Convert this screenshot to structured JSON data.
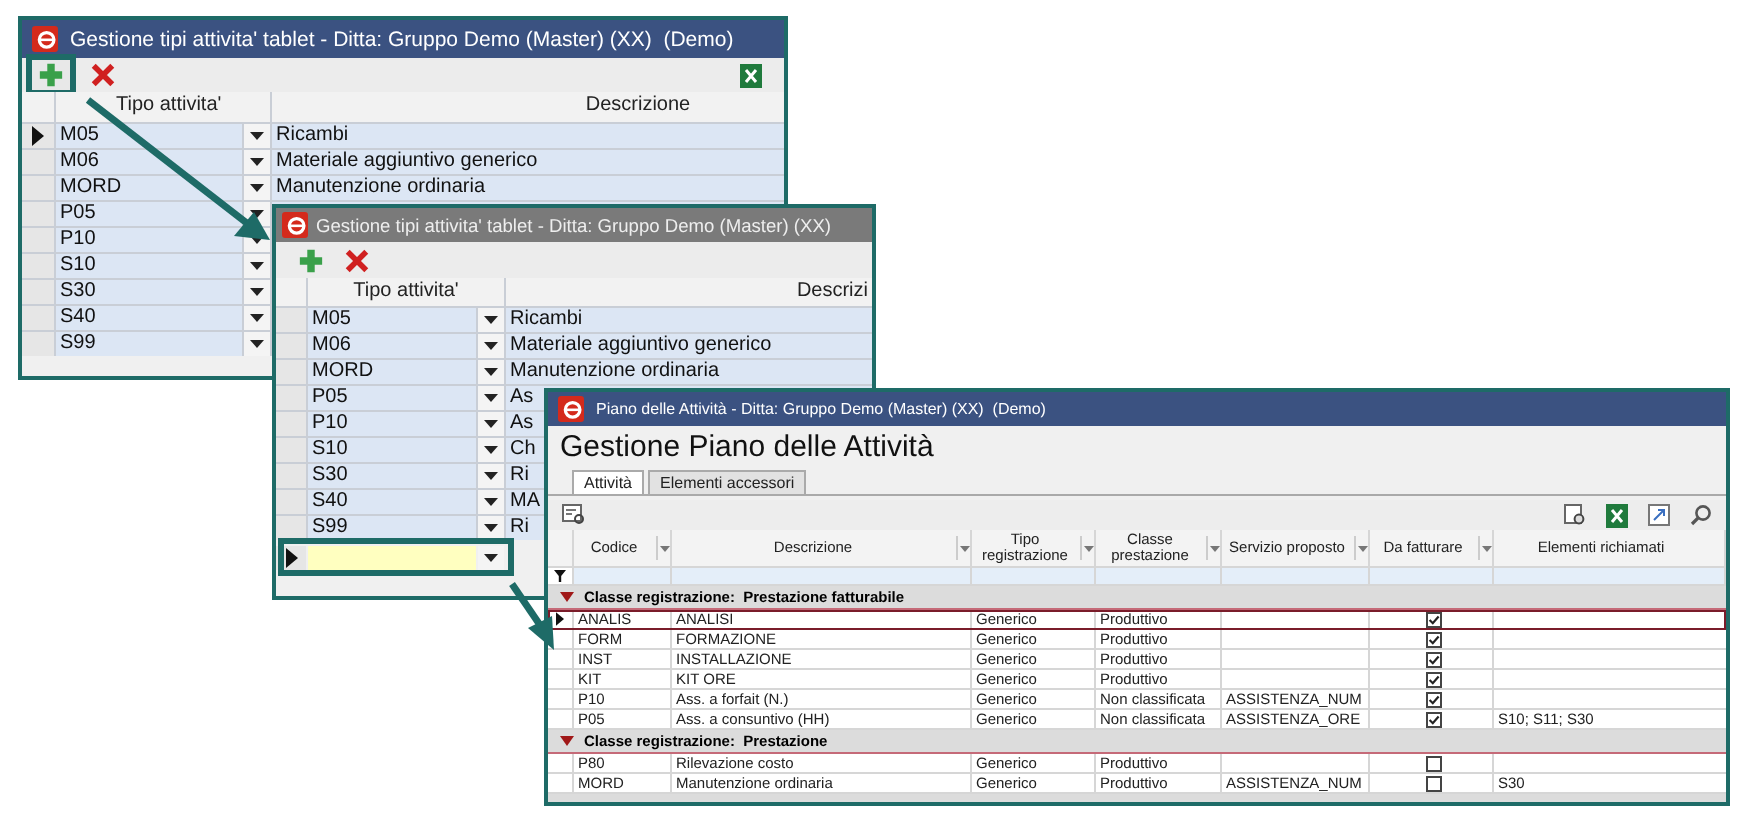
{
  "type_windows": [
    {
      "title": "Gestione tipi attivita' tablet - Ditta: Gruppo Demo (Master) (XX)  (Demo)",
      "active": true,
      "columns": [
        "Tipo attivita'",
        "Descrizione"
      ],
      "rows": [
        {
          "code": "M05",
          "description": "Ricambi",
          "selected": true
        },
        {
          "code": "M06",
          "description": "Materiale aggiuntivo generico",
          "selected": false
        },
        {
          "code": "MORD",
          "description": "Manutenzione ordinaria",
          "selected": false
        },
        {
          "code": "P05",
          "selected": false
        },
        {
          "code": "P10",
          "selected": false
        },
        {
          "code": "S10",
          "selected": false
        },
        {
          "code": "S30",
          "selected": false
        },
        {
          "code": "S40",
          "selected": false
        },
        {
          "code": "S99",
          "selected": false
        }
      ]
    },
    {
      "title": "Gestione tipi attivita' tablet - Ditta: Gruppo Demo (Master) (XX)",
      "active": false,
      "columns": [
        "Tipo attivita'",
        "Descrizi"
      ],
      "rows": [
        {
          "code": "M05",
          "description": "Ricambi",
          "selected": false
        },
        {
          "code": "M06",
          "description": "Materiale aggiuntivo generico",
          "selected": false
        },
        {
          "code": "MORD",
          "description": "Manutenzione ordinaria",
          "selected": false
        },
        {
          "code": "P05",
          "description": "As",
          "selected": false
        },
        {
          "code": "P10",
          "description": "As",
          "selected": false
        },
        {
          "code": "S10",
          "description": "Ch",
          "selected": false
        },
        {
          "code": "S30",
          "description": "Ri",
          "selected": false
        },
        {
          "code": "S40",
          "description": "MA",
          "selected": false
        },
        {
          "code": "S99",
          "description": "Ri",
          "selected": false
        }
      ],
      "new_row": {
        "selected": true
      }
    }
  ],
  "plan_window": {
    "title": "Piano delle Attività - Ditta: Gruppo Demo (Master) (XX)  (Demo)",
    "active": true,
    "heading": "Gestione Piano delle Attività",
    "tabs": [
      {
        "label": "Attività",
        "selected": true
      },
      {
        "label": "Elementi accessori",
        "selected": false
      }
    ],
    "columns": [
      "Codice",
      "Descrizione",
      "Tipo registrazione",
      "Classe prestazione",
      "Servizio proposto",
      "Da fatturare",
      "Elementi richiamati"
    ],
    "groups": [
      {
        "label": "Classe registrazione:  Prestazione fatturabile",
        "expanded": true,
        "rows": [
          {
            "code": "ANALIS",
            "description": "ANALISI",
            "type": "Generico",
            "class": "Produttivo",
            "billable": true,
            "selected": true
          },
          {
            "code": "FORM",
            "description": "FORMAZIONE",
            "type": "Generico",
            "class": "Produttivo",
            "billable": true,
            "selected": false
          },
          {
            "code": "INST",
            "description": "INSTALLAZIONE",
            "type": "Generico",
            "class": "Produttivo",
            "billable": true,
            "selected": false
          },
          {
            "code": "KIT",
            "description": "KIT ORE",
            "type": "Generico",
            "class": "Produttivo",
            "billable": true,
            "selected": false
          },
          {
            "code": "P10",
            "description": "Ass. a forfait (N.)",
            "type": "Generico",
            "class": "Non classificata",
            "service": "ASSISTENZA_NUM",
            "billable": true,
            "selected": false
          },
          {
            "code": "P05",
            "description": "Ass. a consuntivo (HH)",
            "type": "Generico",
            "class": "Non classificata",
            "service": "ASSISTENZA_ORE",
            "billable": true,
            "linked": "S10; S11; S30",
            "selected": false
          }
        ]
      },
      {
        "label": "Classe registrazione:  Prestazione",
        "expanded": true,
        "rows": [
          {
            "code": "P80",
            "description": "Rilevazione costo",
            "type": "Generico",
            "class": "Produttivo",
            "billable": false,
            "selected": false
          },
          {
            "code": "MORD",
            "description": "Manutenzione ordinaria",
            "type": "Generico",
            "class": "Produttivo",
            "service": "ASSISTENZA_NUM",
            "billable": false,
            "linked": "S30",
            "selected": false
          }
        ]
      }
    ]
  }
}
